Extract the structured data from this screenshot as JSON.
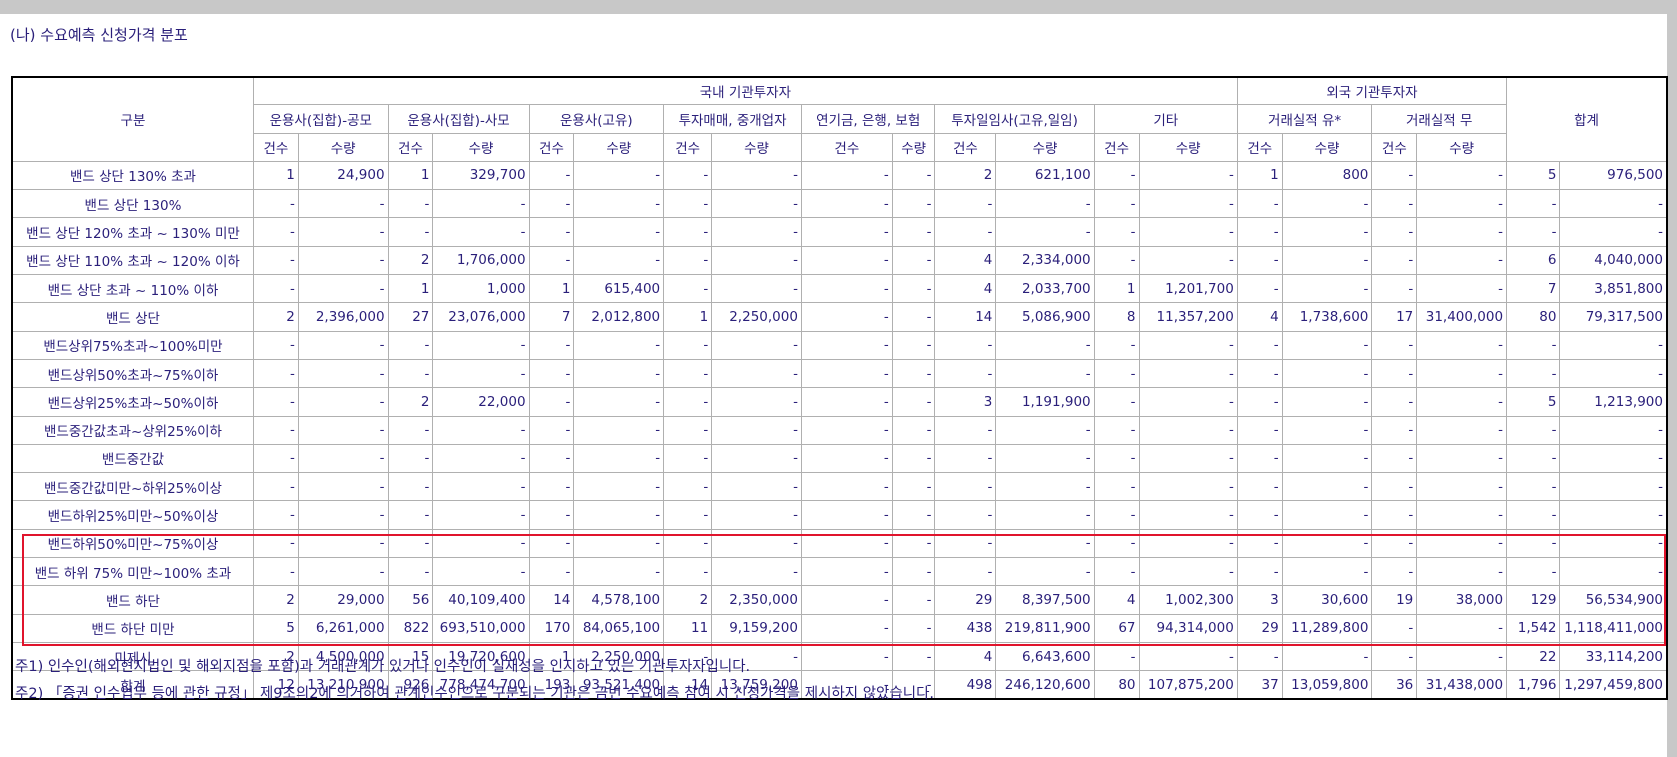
{
  "title": "(나) 수요예측 신청가격 분포",
  "headers": {
    "category": "구분",
    "domestic": "국내 기관투자자",
    "foreign": "외국 기관투자자",
    "total": "합계",
    "groups": [
      "운용사(집합)-공모",
      "운용사(집합)-사모",
      "운용사(고유)",
      "투자매매, 중개업자",
      "연기금, 은행, 보험",
      "투자일임사(고유,일임)",
      "기타",
      "거래실적 유*",
      "거래실적 무"
    ],
    "count": "건수",
    "qty": "수량"
  },
  "rows": [
    {
      "label": "밴드 상단 130% 초과",
      "cells": [
        "1",
        "24,900",
        "1",
        "329,700",
        "-",
        "-",
        "-",
        "-",
        "-",
        "-",
        "2",
        "621,100",
        "-",
        "-",
        "1",
        "800",
        "-",
        "-",
        "5",
        "976,500"
      ]
    },
    {
      "label": "밴드 상단 130%",
      "cells": [
        "-",
        "-",
        "-",
        "-",
        "-",
        "-",
        "-",
        "-",
        "-",
        "-",
        "-",
        "-",
        "-",
        "-",
        "-",
        "-",
        "-",
        "-",
        "-",
        "-"
      ]
    },
    {
      "label": "밴드 상단 120% 초과 ~ 130% 미만",
      "cells": [
        "-",
        "-",
        "-",
        "-",
        "-",
        "-",
        "-",
        "-",
        "-",
        "-",
        "-",
        "-",
        "-",
        "-",
        "-",
        "-",
        "-",
        "-",
        "-",
        "-"
      ]
    },
    {
      "label": "밴드 상단 110% 초과 ~ 120% 이하",
      "cells": [
        "-",
        "-",
        "2",
        "1,706,000",
        "-",
        "-",
        "-",
        "-",
        "-",
        "-",
        "4",
        "2,334,000",
        "-",
        "-",
        "-",
        "-",
        "-",
        "-",
        "6",
        "4,040,000"
      ]
    },
    {
      "label": "밴드 상단 초과 ~ 110% 이하",
      "cells": [
        "-",
        "-",
        "1",
        "1,000",
        "1",
        "615,400",
        "-",
        "-",
        "-",
        "-",
        "4",
        "2,033,700",
        "1",
        "1,201,700",
        "-",
        "-",
        "-",
        "-",
        "7",
        "3,851,800"
      ]
    },
    {
      "label": "밴드 상단",
      "cells": [
        "2",
        "2,396,000",
        "27",
        "23,076,000",
        "7",
        "2,012,800",
        "1",
        "2,250,000",
        "-",
        "-",
        "14",
        "5,086,900",
        "8",
        "11,357,200",
        "4",
        "1,738,600",
        "17",
        "31,400,000",
        "80",
        "79,317,500"
      ]
    },
    {
      "label": "밴드상위75%초과~100%미만",
      "cells": [
        "-",
        "-",
        "-",
        "-",
        "-",
        "-",
        "-",
        "-",
        "-",
        "-",
        "-",
        "-",
        "-",
        "-",
        "-",
        "-",
        "-",
        "-",
        "-",
        "-"
      ]
    },
    {
      "label": "밴드상위50%초과~75%이하",
      "cells": [
        "-",
        "-",
        "-",
        "-",
        "-",
        "-",
        "-",
        "-",
        "-",
        "-",
        "-",
        "-",
        "-",
        "-",
        "-",
        "-",
        "-",
        "-",
        "-",
        "-"
      ]
    },
    {
      "label": "밴드상위25%초과~50%이하",
      "cells": [
        "-",
        "-",
        "2",
        "22,000",
        "-",
        "-",
        "-",
        "-",
        "-",
        "-",
        "3",
        "1,191,900",
        "-",
        "-",
        "-",
        "-",
        "-",
        "-",
        "5",
        "1,213,900"
      ]
    },
    {
      "label": "밴드중간값초과~상위25%이하",
      "cells": [
        "-",
        "-",
        "-",
        "-",
        "-",
        "-",
        "-",
        "-",
        "-",
        "-",
        "-",
        "-",
        "-",
        "-",
        "-",
        "-",
        "-",
        "-",
        "-",
        "-"
      ]
    },
    {
      "label": "밴드중간값",
      "cells": [
        "-",
        "-",
        "-",
        "-",
        "-",
        "-",
        "-",
        "-",
        "-",
        "-",
        "-",
        "-",
        "-",
        "-",
        "-",
        "-",
        "-",
        "-",
        "-",
        "-"
      ]
    },
    {
      "label": "밴드중간값미만~하위25%이상",
      "cells": [
        "-",
        "-",
        "-",
        "-",
        "-",
        "-",
        "-",
        "-",
        "-",
        "-",
        "-",
        "-",
        "-",
        "-",
        "-",
        "-",
        "-",
        "-",
        "-",
        "-"
      ]
    },
    {
      "label": "밴드하위25%미만~50%이상",
      "cells": [
        "-",
        "-",
        "-",
        "-",
        "-",
        "-",
        "-",
        "-",
        "-",
        "-",
        "-",
        "-",
        "-",
        "-",
        "-",
        "-",
        "-",
        "-",
        "-",
        "-"
      ]
    },
    {
      "label": "밴드하위50%미만~75%이상",
      "cells": [
        "-",
        "-",
        "-",
        "-",
        "-",
        "-",
        "-",
        "-",
        "-",
        "-",
        "-",
        "-",
        "-",
        "-",
        "-",
        "-",
        "-",
        "-",
        "-",
        "-"
      ]
    },
    {
      "label": "밴드 하위 75% 미만~100% 초과",
      "cells": [
        "-",
        "-",
        "-",
        "-",
        "-",
        "-",
        "-",
        "-",
        "-",
        "-",
        "-",
        "-",
        "-",
        "-",
        "-",
        "-",
        "-",
        "-",
        "-",
        "-"
      ]
    },
    {
      "label": "밴드 하단",
      "cells": [
        "2",
        "29,000",
        "56",
        "40,109,400",
        "14",
        "4,578,100",
        "2",
        "2,350,000",
        "-",
        "-",
        "29",
        "8,397,500",
        "4",
        "1,002,300",
        "3",
        "30,600",
        "19",
        "38,000",
        "129",
        "56,534,900"
      ]
    },
    {
      "label": "밴드 하단 미만",
      "cells": [
        "5",
        "6,261,000",
        "822",
        "693,510,000",
        "170",
        "84,065,100",
        "11",
        "9,159,200",
        "-",
        "-",
        "438",
        "219,811,900",
        "67",
        "94,314,000",
        "29",
        "11,289,800",
        "-",
        "-",
        "1,542",
        "1,118,411,000"
      ]
    },
    {
      "label": "미제시",
      "cells": [
        "2",
        "4,500,000",
        "15",
        "19,720,600",
        "1",
        "2,250,000",
        "-",
        "-",
        "-",
        "-",
        "4",
        "6,643,600",
        "-",
        "-",
        "-",
        "-",
        "-",
        "-",
        "22",
        "33,114,200"
      ]
    },
    {
      "label": "합계",
      "cells": [
        "12",
        "13,210,900",
        "926",
        "778,474,700",
        "193",
        "93,521,400",
        "14",
        "13,759,200",
        "-",
        "-",
        "498",
        "246,120,600",
        "80",
        "107,875,200",
        "37",
        "13,059,800",
        "36",
        "31,438,000",
        "1,796",
        "1,297,459,800"
      ]
    }
  ],
  "notes": [
    "주1) 인수인(해외현지법인 및 해외지점을 포함)과 거래관계가 있거나 인수인이 실재성을 인지하고 있는 기관투자자입니다.",
    "주2) 「증권 인수업무 등에 관한 규정」 제9조의2에 의거하여 관계인수인으로 구분되는 기관은 금번 수요예측 참여 시 신청가격을 제시하지 않았습니다."
  ]
}
